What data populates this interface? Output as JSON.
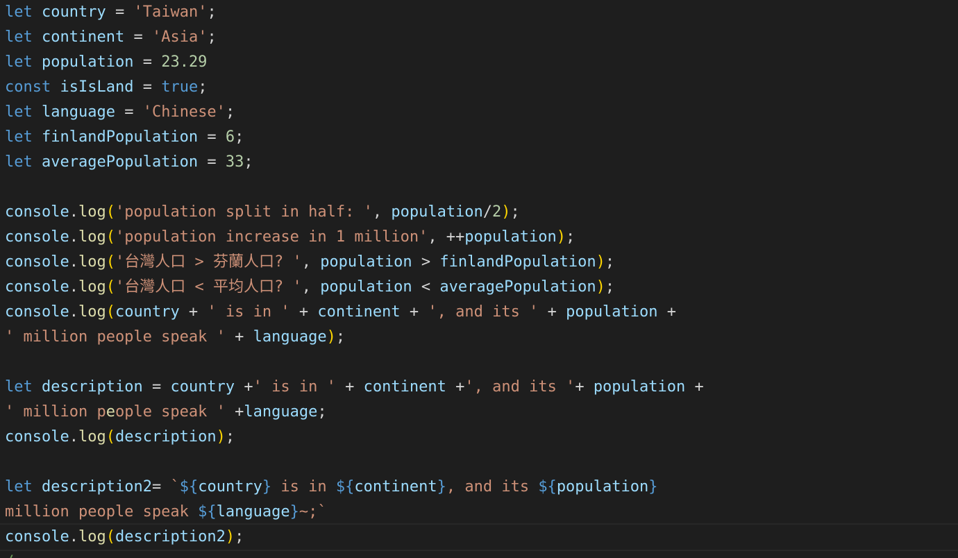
{
  "editor": {
    "lines": [
      [
        [
          "kw",
          "let"
        ],
        [
          "op",
          " "
        ],
        [
          "var",
          "country"
        ],
        [
          "op",
          " = "
        ],
        [
          "str",
          "'Taiwan'"
        ],
        [
          "op",
          ";"
        ]
      ],
      [
        [
          "kw",
          "let"
        ],
        [
          "op",
          " "
        ],
        [
          "var",
          "continent"
        ],
        [
          "op",
          " = "
        ],
        [
          "str",
          "'Asia'"
        ],
        [
          "op",
          ";"
        ]
      ],
      [
        [
          "kw",
          "let"
        ],
        [
          "op",
          " "
        ],
        [
          "var",
          "population"
        ],
        [
          "op",
          " = "
        ],
        [
          "num",
          "23.29"
        ]
      ],
      [
        [
          "kw",
          "const"
        ],
        [
          "op",
          " "
        ],
        [
          "var",
          "isIsLand"
        ],
        [
          "op",
          " = "
        ],
        [
          "kw",
          "true"
        ],
        [
          "op",
          ";"
        ]
      ],
      [
        [
          "kw",
          "let"
        ],
        [
          "op",
          " "
        ],
        [
          "var",
          "language"
        ],
        [
          "op",
          " = "
        ],
        [
          "str",
          "'Chinese'"
        ],
        [
          "op",
          ";"
        ]
      ],
      [
        [
          "kw",
          "let"
        ],
        [
          "op",
          " "
        ],
        [
          "var",
          "finlandPopulation"
        ],
        [
          "op",
          " = "
        ],
        [
          "num",
          "6"
        ],
        [
          "op",
          ";"
        ]
      ],
      [
        [
          "kw",
          "let"
        ],
        [
          "op",
          " "
        ],
        [
          "var",
          "averagePopulation"
        ],
        [
          "op",
          " = "
        ],
        [
          "num",
          "33"
        ],
        [
          "op",
          ";"
        ]
      ],
      [],
      [
        [
          "var",
          "console"
        ],
        [
          "op",
          "."
        ],
        [
          "fn",
          "log"
        ],
        [
          "br",
          "("
        ],
        [
          "str",
          "'population split in half: '"
        ],
        [
          "op",
          ", "
        ],
        [
          "var",
          "population"
        ],
        [
          "op",
          "/"
        ],
        [
          "num",
          "2"
        ],
        [
          "br",
          ")"
        ],
        [
          "op",
          ";"
        ]
      ],
      [
        [
          "var",
          "console"
        ],
        [
          "op",
          "."
        ],
        [
          "fn",
          "log"
        ],
        [
          "br",
          "("
        ],
        [
          "str",
          "'population increase in 1 million'"
        ],
        [
          "op",
          ", ++"
        ],
        [
          "var",
          "population"
        ],
        [
          "br",
          ")"
        ],
        [
          "op",
          ";"
        ]
      ],
      [
        [
          "var",
          "console"
        ],
        [
          "op",
          "."
        ],
        [
          "fn",
          "log"
        ],
        [
          "br",
          "("
        ],
        [
          "str",
          "'台灣人口 > 芬蘭人口? '"
        ],
        [
          "op",
          ", "
        ],
        [
          "var",
          "population"
        ],
        [
          "op",
          " > "
        ],
        [
          "var",
          "finlandPopulation"
        ],
        [
          "br",
          ")"
        ],
        [
          "op",
          ";"
        ]
      ],
      [
        [
          "var",
          "console"
        ],
        [
          "op",
          "."
        ],
        [
          "fn",
          "log"
        ],
        [
          "br",
          "("
        ],
        [
          "str",
          "'台灣人口 < 平均人口? '"
        ],
        [
          "op",
          ", "
        ],
        [
          "var",
          "population"
        ],
        [
          "op",
          " < "
        ],
        [
          "var",
          "averagePopulation"
        ],
        [
          "br",
          ")"
        ],
        [
          "op",
          ";"
        ]
      ],
      [
        [
          "var",
          "console"
        ],
        [
          "op",
          "."
        ],
        [
          "fn",
          "log"
        ],
        [
          "br",
          "("
        ],
        [
          "var",
          "country"
        ],
        [
          "op",
          " + "
        ],
        [
          "str",
          "' is in '"
        ],
        [
          "op",
          " + "
        ],
        [
          "var",
          "continent"
        ],
        [
          "op",
          " + "
        ],
        [
          "str",
          "', and its '"
        ],
        [
          "op",
          " + "
        ],
        [
          "var",
          "population"
        ],
        [
          "op",
          " +"
        ]
      ],
      [
        [
          "str",
          "' million people speak '"
        ],
        [
          "op",
          " + "
        ],
        [
          "var",
          "language"
        ],
        [
          "br",
          ")"
        ],
        [
          "op",
          ";"
        ]
      ],
      [],
      [
        [
          "kw",
          "let"
        ],
        [
          "op",
          " "
        ],
        [
          "var",
          "description"
        ],
        [
          "op",
          " = "
        ],
        [
          "var",
          "country"
        ],
        [
          "op",
          " +"
        ],
        [
          "str",
          "' is in '"
        ],
        [
          "op",
          " + "
        ],
        [
          "var",
          "continent"
        ],
        [
          "op",
          " +"
        ],
        [
          "str",
          "', and its '"
        ],
        [
          "op",
          "+ "
        ],
        [
          "var",
          "population"
        ],
        [
          "op",
          " +"
        ]
      ],
      [
        [
          "str",
          "' million p"
        ],
        [
          "fn",
          "e"
        ],
        [
          "str",
          "ople speak '"
        ],
        [
          "op",
          " +"
        ],
        [
          "var",
          "language"
        ],
        [
          "op",
          ";"
        ]
      ],
      [
        [
          "var",
          "console"
        ],
        [
          "op",
          "."
        ],
        [
          "fn",
          "log"
        ],
        [
          "br",
          "("
        ],
        [
          "var",
          "description"
        ],
        [
          "br",
          ")"
        ],
        [
          "op",
          ";"
        ]
      ],
      [],
      [
        [
          "kw",
          "let"
        ],
        [
          "op",
          " "
        ],
        [
          "var",
          "description2"
        ],
        [
          "op",
          "= "
        ],
        [
          "str",
          "`"
        ],
        [
          "tpl",
          "${"
        ],
        [
          "var",
          "country"
        ],
        [
          "tpl",
          "}"
        ],
        [
          "str",
          " is in "
        ],
        [
          "tpl",
          "${"
        ],
        [
          "var",
          "continent"
        ],
        [
          "tpl",
          "}"
        ],
        [
          "str",
          ", and its "
        ],
        [
          "tpl",
          "${"
        ],
        [
          "var",
          "population"
        ],
        [
          "tpl",
          "}"
        ]
      ],
      [
        [
          "str",
          "million people speak "
        ],
        [
          "tpl",
          "${"
        ],
        [
          "var",
          "language"
        ],
        [
          "tpl",
          "}"
        ],
        [
          "str",
          "~;`"
        ]
      ],
      [
        [
          "var",
          "console"
        ],
        [
          "op",
          "."
        ],
        [
          "fn",
          "log"
        ],
        [
          "br",
          "("
        ],
        [
          "var",
          "description2"
        ],
        [
          "br",
          ")"
        ],
        [
          "op",
          ";"
        ]
      ],
      [
        [
          "dim",
          "/"
        ]
      ]
    ],
    "current_line_index": 21
  },
  "colors": {
    "background": "#1e1e1e",
    "keyword": "#569cd6",
    "variable": "#9cdcfe",
    "string": "#ce9178",
    "number": "#b5cea8",
    "function": "#dcdcaa",
    "bracket": "#ffd700"
  }
}
